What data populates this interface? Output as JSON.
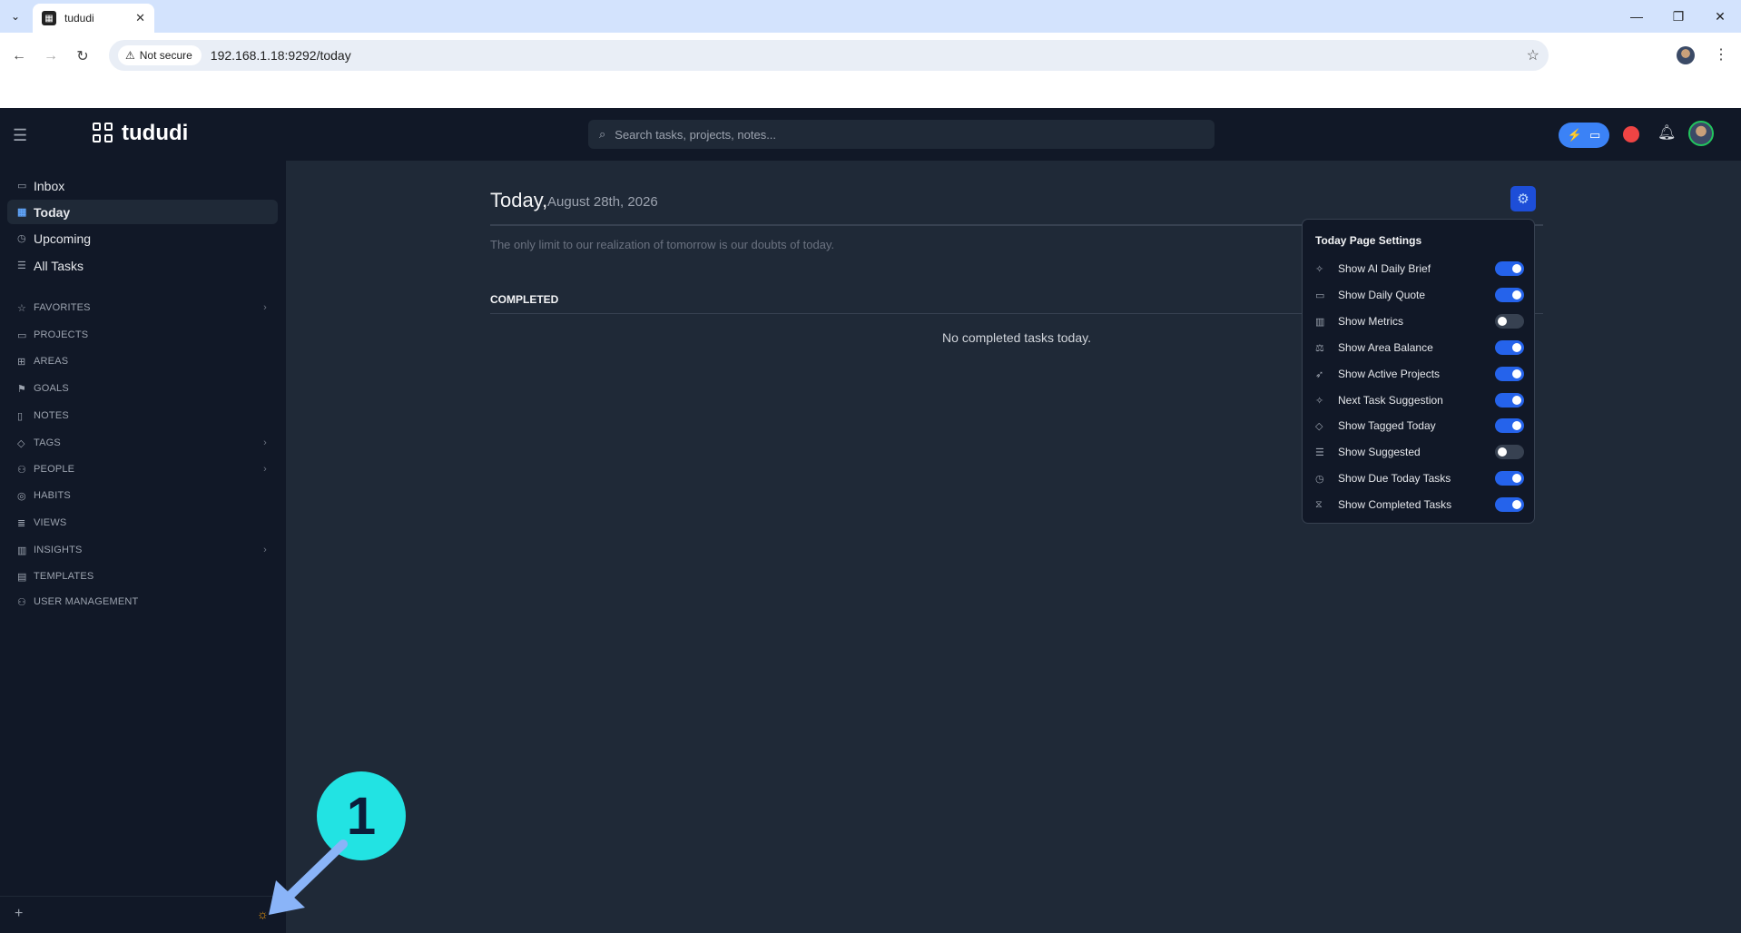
{
  "browser": {
    "tab_title": "tududi",
    "security_label": "Not secure",
    "url": "192.168.1.18:9292/today"
  },
  "header": {
    "app_name": "tududi",
    "search_placeholder": "Search tasks, projects, notes..."
  },
  "sidebar": {
    "nav": [
      {
        "label": "Inbox",
        "icon": "inbox-icon"
      },
      {
        "label": "Today",
        "icon": "calendar-icon",
        "active": true
      },
      {
        "label": "Upcoming",
        "icon": "clock-icon"
      },
      {
        "label": "All Tasks",
        "icon": "list-icon"
      }
    ],
    "sections": [
      {
        "label": "FAVORITES",
        "icon": "star-icon"
      },
      {
        "label": "PROJECTS",
        "icon": "folder-icon"
      },
      {
        "label": "AREAS",
        "icon": "grid-icon"
      },
      {
        "label": "GOALS",
        "icon": "flag-icon"
      },
      {
        "label": "NOTES",
        "icon": "book-icon"
      },
      {
        "label": "TAGS",
        "icon": "tag-icon"
      },
      {
        "label": "PEOPLE",
        "icon": "people-icon"
      },
      {
        "label": "HABITS",
        "icon": "habit-icon"
      },
      {
        "label": "VIEWS",
        "icon": "views-icon"
      },
      {
        "label": "INSIGHTS",
        "icon": "chart-icon"
      },
      {
        "label": "TEMPLATES",
        "icon": "template-icon"
      },
      {
        "label": "USER MANAGEMENT",
        "icon": "users-icon"
      }
    ]
  },
  "main": {
    "title": "Today,",
    "date": "August 28th, 2026",
    "quote": "The only limit to our realization of tomorrow is our doubts of today.",
    "completed_heading": "COMPLETED",
    "empty_message": "No completed tasks today."
  },
  "settings": {
    "title": "Today Page Settings",
    "options": [
      {
        "label": "Show AI Daily Brief",
        "on": true,
        "icon": "sparkle-icon"
      },
      {
        "label": "Show Daily Quote",
        "on": true,
        "icon": "quote-icon"
      },
      {
        "label": "Show Metrics",
        "on": false,
        "icon": "bar-chart-icon"
      },
      {
        "label": "Show Area Balance",
        "on": true,
        "icon": "scale-icon"
      },
      {
        "label": "Show Active Projects",
        "on": true,
        "icon": "rocket-icon"
      },
      {
        "label": "Next Task Suggestion",
        "on": true,
        "icon": "sparkle-icon"
      },
      {
        "label": "Show Tagged Today",
        "on": true,
        "icon": "tag-icon"
      },
      {
        "label": "Show Suggested",
        "on": false,
        "icon": "list-icon"
      },
      {
        "label": "Show Due Today Tasks",
        "on": true,
        "icon": "clock-icon"
      },
      {
        "label": "Show Completed Tasks",
        "on": true,
        "icon": "hourglass-icon"
      }
    ]
  },
  "annotation": {
    "badge_number": "1"
  }
}
